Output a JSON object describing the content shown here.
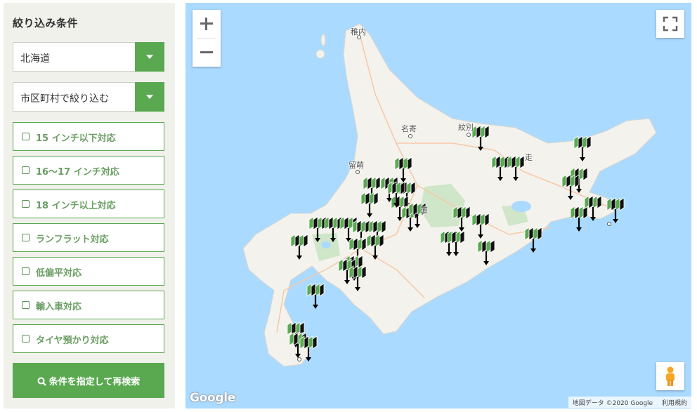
{
  "sidebar": {
    "title": "絞り込み条件",
    "prefecture_select": "北海道",
    "city_select": "市区町村で絞り込む",
    "filters": [
      "15 インチ以下対応",
      "16〜17 インチ対応",
      "18 インチ以上対応",
      "ランフラット対応",
      "低偏平対応",
      "輸入車対応",
      "タイヤ預かり対応"
    ],
    "search_button": "条件を指定して再検索"
  },
  "map": {
    "city_labels": [
      "稚内",
      "名寄",
      "紋別",
      "留萌",
      "道",
      "走"
    ],
    "google_logo": "Google",
    "attribution": {
      "data": "地図データ ©2020 Google",
      "terms": "利用規約"
    },
    "colors": {
      "water": "#aadaff",
      "land": "#f4f2ec",
      "park": "#cfe6c9",
      "road": "#f5c9a8",
      "marker_green": "#5aa951"
    },
    "marker_icon": "shop-flag-marker-icon"
  }
}
